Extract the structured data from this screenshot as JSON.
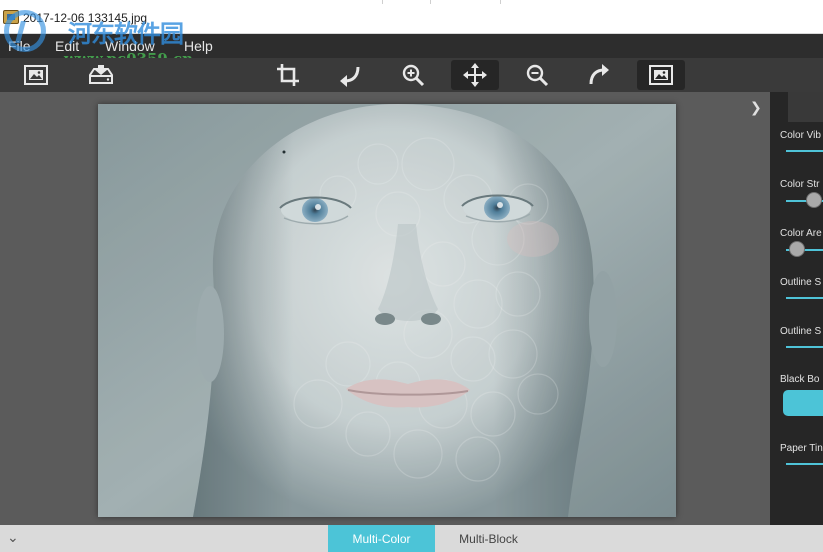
{
  "window": {
    "title": "2017-12-06 133145.jpg"
  },
  "watermark": {
    "text_cn": "河东软件园",
    "url": "www.pc0359.cn"
  },
  "menu": [
    "File",
    "Edit",
    "Window",
    "Help"
  ],
  "toolbar": {
    "tools": [
      "open-image-icon",
      "save-icon",
      "crop-icon",
      "rotate-left-icon",
      "zoom-in-icon",
      "move-icon",
      "zoom-out-icon",
      "rotate-right-icon",
      "fit-image-icon"
    ],
    "active_tools": [
      "move-icon",
      "fit-image-icon"
    ]
  },
  "panel": {
    "params": [
      {
        "label": "Color Vib",
        "slider_value": 1.0
      },
      {
        "label": "Color Str",
        "slider_value": 0.6
      },
      {
        "label": "Color Are",
        "slider_value": 0.3
      },
      {
        "label": "Outline S",
        "slider_value": 1.0
      },
      {
        "label": "Outline S",
        "slider_value": 1.0
      },
      {
        "label": "Black Bo",
        "toggle_on": true
      },
      {
        "label": "Paper Tin",
        "slider_value": 1.0
      }
    ]
  },
  "bottom_tabs": [
    {
      "label": "Multi-Color",
      "active": true
    },
    {
      "label": "Multi-Block",
      "active": false
    }
  ],
  "colors": {
    "accent": "#4cc4d7",
    "menubar": "#2d2d2d",
    "toolbar": "#3a3a3a",
    "workspace": "#5b5b5b",
    "panel": "#262626"
  }
}
